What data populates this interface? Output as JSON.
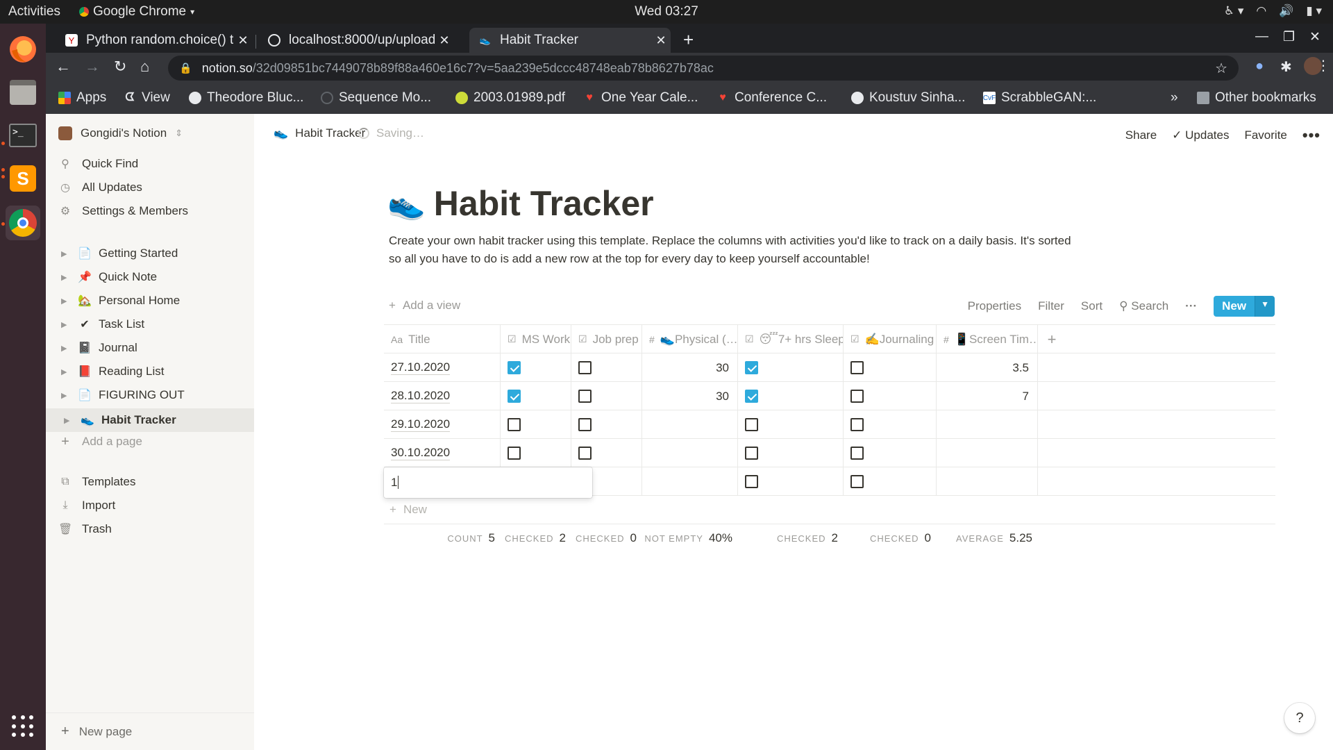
{
  "topbar": {
    "activities": "Activities",
    "app": "Google Chrome",
    "clock": "Wed 03:27"
  },
  "tabs": [
    {
      "title": "Python random.choice() t",
      "active": false
    },
    {
      "title": "localhost:8000/up/upload",
      "active": false
    },
    {
      "title": "Habit Tracker",
      "active": true
    }
  ],
  "omnibox": {
    "host": "notion.so",
    "path": "/32d09851bc7449078b89f88a460e16c7?v=5aa239e5dccc48748eab78b8627b78ac"
  },
  "bookmarks": [
    "Apps",
    "View",
    "Theodore Bluc...",
    "Sequence Mo...",
    "2003.01989.pdf",
    "One Year Cale...",
    "Conference C...",
    "Koustuv Sinha...",
    "ScrabbleGAN:..."
  ],
  "bookmarks_more": "»",
  "other_bookmarks": "Other bookmarks",
  "sidebar": {
    "workspace": "Gongidi's Notion",
    "nav": [
      {
        "label": "Quick Find",
        "icon": "search-icon"
      },
      {
        "label": "All Updates",
        "icon": "clock-icon"
      },
      {
        "label": "Settings & Members",
        "icon": "gear-icon"
      }
    ],
    "pages": [
      {
        "label": "Getting Started",
        "icon": "📄"
      },
      {
        "label": "Quick Note",
        "icon": "📌"
      },
      {
        "label": "Personal Home",
        "icon": "🏡"
      },
      {
        "label": "Task List",
        "icon": "✔"
      },
      {
        "label": "Journal",
        "icon": "📓"
      },
      {
        "label": "Reading List",
        "icon": "📕"
      },
      {
        "label": "FIGURING OUT",
        "icon": "📄"
      },
      {
        "label": "Habit Tracker",
        "icon": "👟"
      }
    ],
    "add_page": "Add a page",
    "tools": [
      {
        "label": "Templates",
        "icon": "templates-icon"
      },
      {
        "label": "Import",
        "icon": "import-icon"
      },
      {
        "label": "Trash",
        "icon": "trash-icon"
      }
    ],
    "new_page": "New page"
  },
  "topnav": {
    "breadcrumb": "Habit Tracker",
    "status": "Saving…",
    "share": "Share",
    "updates": "Updates",
    "favorite": "Favorite"
  },
  "page": {
    "title": "Habit Tracker",
    "description": "Create your own habit tracker using this template. Replace the columns with activities you'd like to track on a daily basis. It's sorted so all you have to do is add a new row at the top for every day to keep yourself accountable!"
  },
  "viewbar": {
    "add_view": "Add a view",
    "properties": "Properties",
    "filter": "Filter",
    "sort": "Sort",
    "search": "Search",
    "new": "New"
  },
  "table": {
    "columns": [
      "Title",
      "MS Work",
      "Job prep",
      "👟Physical (…",
      "😴7+ hrs Sleep",
      "✍️Journaling",
      "📱Screen Tim…"
    ],
    "rows": [
      {
        "title": "27.10.2020",
        "ms_work": true,
        "job_prep": false,
        "physical": "30",
        "sleep": true,
        "journaling": false,
        "screen": "3.5"
      },
      {
        "title": "28.10.2020",
        "ms_work": true,
        "job_prep": false,
        "physical": "30",
        "sleep": true,
        "journaling": false,
        "screen": "7"
      },
      {
        "title": "29.10.2020",
        "ms_work": false,
        "job_prep": false,
        "physical": "",
        "sleep": false,
        "journaling": false,
        "screen": ""
      },
      {
        "title": "30.10.2020",
        "ms_work": false,
        "job_prep": false,
        "physical": "",
        "sleep": false,
        "journaling": false,
        "screen": ""
      }
    ],
    "editing_value": "1",
    "add_row": "New",
    "calcs": [
      {
        "key": "COUNT",
        "value": "5"
      },
      {
        "key": "CHECKED",
        "value": "2"
      },
      {
        "key": "CHECKED",
        "value": "0"
      },
      {
        "key": "NOT EMPTY",
        "value": "40%"
      },
      {
        "key": "CHECKED",
        "value": "2"
      },
      {
        "key": "CHECKED",
        "value": "0"
      },
      {
        "key": "AVERAGE",
        "value": "5.25"
      }
    ]
  },
  "help": "?"
}
